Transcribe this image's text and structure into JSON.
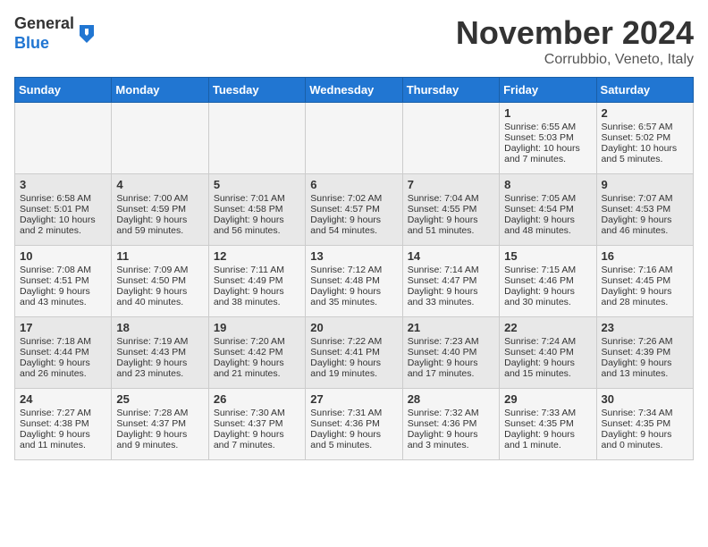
{
  "header": {
    "logo_line1": "General",
    "logo_line2": "Blue",
    "month_title": "November 2024",
    "location": "Corrubbio, Veneto, Italy"
  },
  "days_of_week": [
    "Sunday",
    "Monday",
    "Tuesday",
    "Wednesday",
    "Thursday",
    "Friday",
    "Saturday"
  ],
  "weeks": [
    {
      "cells": [
        {
          "day": "",
          "content": ""
        },
        {
          "day": "",
          "content": ""
        },
        {
          "day": "",
          "content": ""
        },
        {
          "day": "",
          "content": ""
        },
        {
          "day": "",
          "content": ""
        },
        {
          "day": "1",
          "content": "Sunrise: 6:55 AM\nSunset: 5:03 PM\nDaylight: 10 hours and 7 minutes."
        },
        {
          "day": "2",
          "content": "Sunrise: 6:57 AM\nSunset: 5:02 PM\nDaylight: 10 hours and 5 minutes."
        }
      ]
    },
    {
      "cells": [
        {
          "day": "3",
          "content": "Sunrise: 6:58 AM\nSunset: 5:01 PM\nDaylight: 10 hours and 2 minutes."
        },
        {
          "day": "4",
          "content": "Sunrise: 7:00 AM\nSunset: 4:59 PM\nDaylight: 9 hours and 59 minutes."
        },
        {
          "day": "5",
          "content": "Sunrise: 7:01 AM\nSunset: 4:58 PM\nDaylight: 9 hours and 56 minutes."
        },
        {
          "day": "6",
          "content": "Sunrise: 7:02 AM\nSunset: 4:57 PM\nDaylight: 9 hours and 54 minutes."
        },
        {
          "day": "7",
          "content": "Sunrise: 7:04 AM\nSunset: 4:55 PM\nDaylight: 9 hours and 51 minutes."
        },
        {
          "day": "8",
          "content": "Sunrise: 7:05 AM\nSunset: 4:54 PM\nDaylight: 9 hours and 48 minutes."
        },
        {
          "day": "9",
          "content": "Sunrise: 7:07 AM\nSunset: 4:53 PM\nDaylight: 9 hours and 46 minutes."
        }
      ]
    },
    {
      "cells": [
        {
          "day": "10",
          "content": "Sunrise: 7:08 AM\nSunset: 4:51 PM\nDaylight: 9 hours and 43 minutes."
        },
        {
          "day": "11",
          "content": "Sunrise: 7:09 AM\nSunset: 4:50 PM\nDaylight: 9 hours and 40 minutes."
        },
        {
          "day": "12",
          "content": "Sunrise: 7:11 AM\nSunset: 4:49 PM\nDaylight: 9 hours and 38 minutes."
        },
        {
          "day": "13",
          "content": "Sunrise: 7:12 AM\nSunset: 4:48 PM\nDaylight: 9 hours and 35 minutes."
        },
        {
          "day": "14",
          "content": "Sunrise: 7:14 AM\nSunset: 4:47 PM\nDaylight: 9 hours and 33 minutes."
        },
        {
          "day": "15",
          "content": "Sunrise: 7:15 AM\nSunset: 4:46 PM\nDaylight: 9 hours and 30 minutes."
        },
        {
          "day": "16",
          "content": "Sunrise: 7:16 AM\nSunset: 4:45 PM\nDaylight: 9 hours and 28 minutes."
        }
      ]
    },
    {
      "cells": [
        {
          "day": "17",
          "content": "Sunrise: 7:18 AM\nSunset: 4:44 PM\nDaylight: 9 hours and 26 minutes."
        },
        {
          "day": "18",
          "content": "Sunrise: 7:19 AM\nSunset: 4:43 PM\nDaylight: 9 hours and 23 minutes."
        },
        {
          "day": "19",
          "content": "Sunrise: 7:20 AM\nSunset: 4:42 PM\nDaylight: 9 hours and 21 minutes."
        },
        {
          "day": "20",
          "content": "Sunrise: 7:22 AM\nSunset: 4:41 PM\nDaylight: 9 hours and 19 minutes."
        },
        {
          "day": "21",
          "content": "Sunrise: 7:23 AM\nSunset: 4:40 PM\nDaylight: 9 hours and 17 minutes."
        },
        {
          "day": "22",
          "content": "Sunrise: 7:24 AM\nSunset: 4:40 PM\nDaylight: 9 hours and 15 minutes."
        },
        {
          "day": "23",
          "content": "Sunrise: 7:26 AM\nSunset: 4:39 PM\nDaylight: 9 hours and 13 minutes."
        }
      ]
    },
    {
      "cells": [
        {
          "day": "24",
          "content": "Sunrise: 7:27 AM\nSunset: 4:38 PM\nDaylight: 9 hours and 11 minutes."
        },
        {
          "day": "25",
          "content": "Sunrise: 7:28 AM\nSunset: 4:37 PM\nDaylight: 9 hours and 9 minutes."
        },
        {
          "day": "26",
          "content": "Sunrise: 7:30 AM\nSunset: 4:37 PM\nDaylight: 9 hours and 7 minutes."
        },
        {
          "day": "27",
          "content": "Sunrise: 7:31 AM\nSunset: 4:36 PM\nDaylight: 9 hours and 5 minutes."
        },
        {
          "day": "28",
          "content": "Sunrise: 7:32 AM\nSunset: 4:36 PM\nDaylight: 9 hours and 3 minutes."
        },
        {
          "day": "29",
          "content": "Sunrise: 7:33 AM\nSunset: 4:35 PM\nDaylight: 9 hours and 1 minute."
        },
        {
          "day": "30",
          "content": "Sunrise: 7:34 AM\nSunset: 4:35 PM\nDaylight: 9 hours and 0 minutes."
        }
      ]
    }
  ]
}
